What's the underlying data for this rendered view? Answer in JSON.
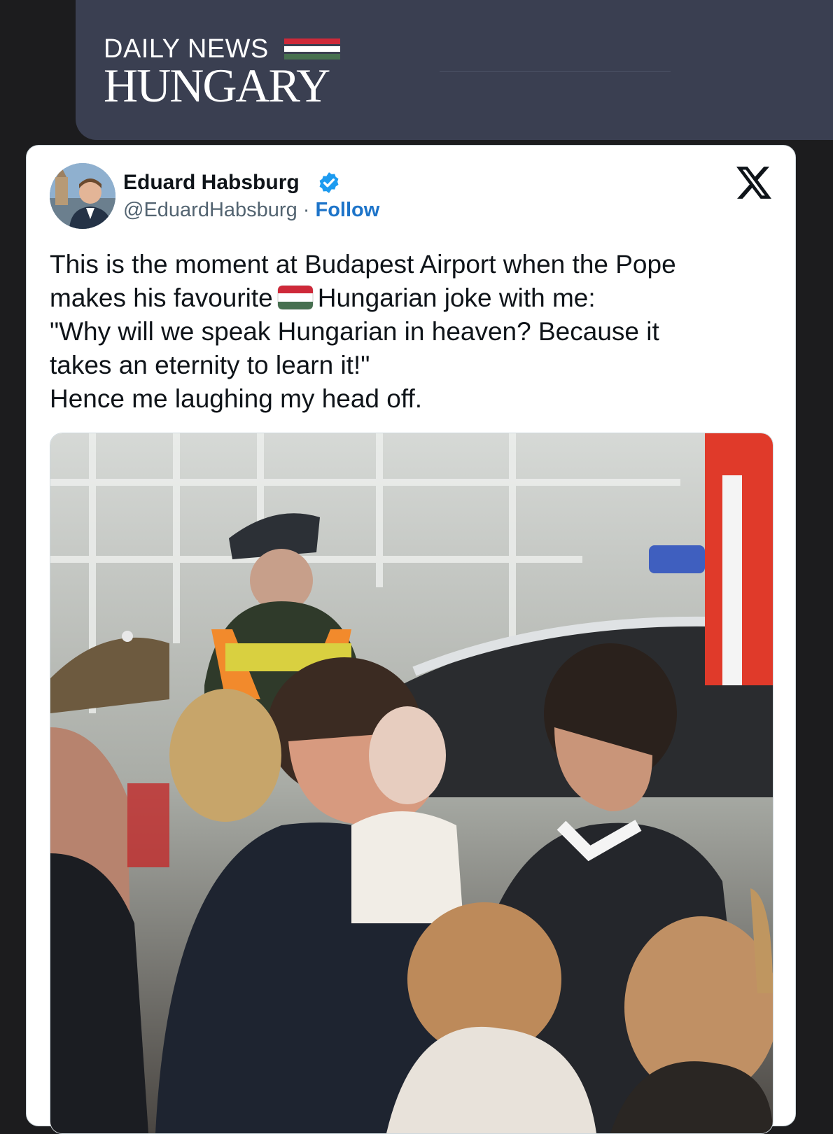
{
  "site": {
    "name_top": "DAILY NEWS",
    "name_main": "HUNGARY",
    "flag_colors": [
      "#ce2939",
      "#ffffff",
      "#477050"
    ]
  },
  "tweet": {
    "author_name": "Eduard Habsburg",
    "handle": "@EduardHabsburg",
    "separator": " · ",
    "follow_label": "Follow",
    "verified_color": "#1d9bf0",
    "brand_icon": "x-logo-icon",
    "text_lines": {
      "l1": "This is the moment at Budapest Airport when the Pope",
      "l2_a": "makes his favourite",
      "l2_b": "Hungarian joke with me:",
      "l3": "\"Why will we speak Hungarian in heaven? Because it",
      "l4": "takes an eternity to learn it!\"",
      "l5": "Hence me laughing my head off."
    },
    "emoji_flag": "hungary-flag-icon"
  }
}
